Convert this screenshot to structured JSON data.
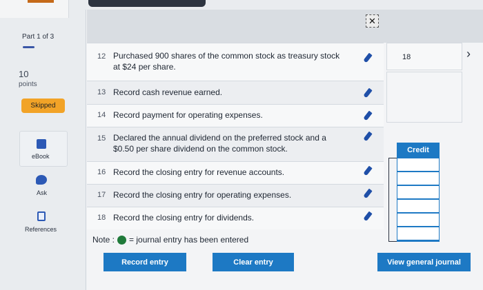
{
  "sidebar": {
    "part_label": "Part 1 of 3",
    "points_value": "10",
    "points_label": "points",
    "status_badge": "Skipped",
    "ebook_label": "eBook",
    "ask_label": "Ask",
    "references_label": "References"
  },
  "entries": [
    {
      "num": "12",
      "text": "Purchased 900 shares of the common stock as treasury stock at $24 per share."
    },
    {
      "num": "13",
      "text": "Record cash revenue earned."
    },
    {
      "num": "14",
      "text": "Record payment for operating expenses."
    },
    {
      "num": "15",
      "text": "Declared the annual dividend on the preferred stock and a $0.50 per share dividend on the common stock."
    },
    {
      "num": "16",
      "text": "Record the closing entry for revenue accounts."
    },
    {
      "num": "17",
      "text": "Record the closing entry for operating expenses."
    },
    {
      "num": "18",
      "text": "Record the closing entry for dividends."
    }
  ],
  "note": {
    "prefix": "Note :",
    "suffix": "= journal entry has been entered"
  },
  "buttons": {
    "record_entry": "Record entry",
    "clear_entry": "Clear entry",
    "view_general_journal": "View general journal"
  },
  "right_panel": {
    "entry_number": "18",
    "chevron": "›",
    "credit_header": "Credit"
  },
  "close_glyph": "✕",
  "colors": {
    "accent_blue": "#1d79c4",
    "badge_orange": "#f2a327",
    "entered_green": "#1f7a3a"
  }
}
